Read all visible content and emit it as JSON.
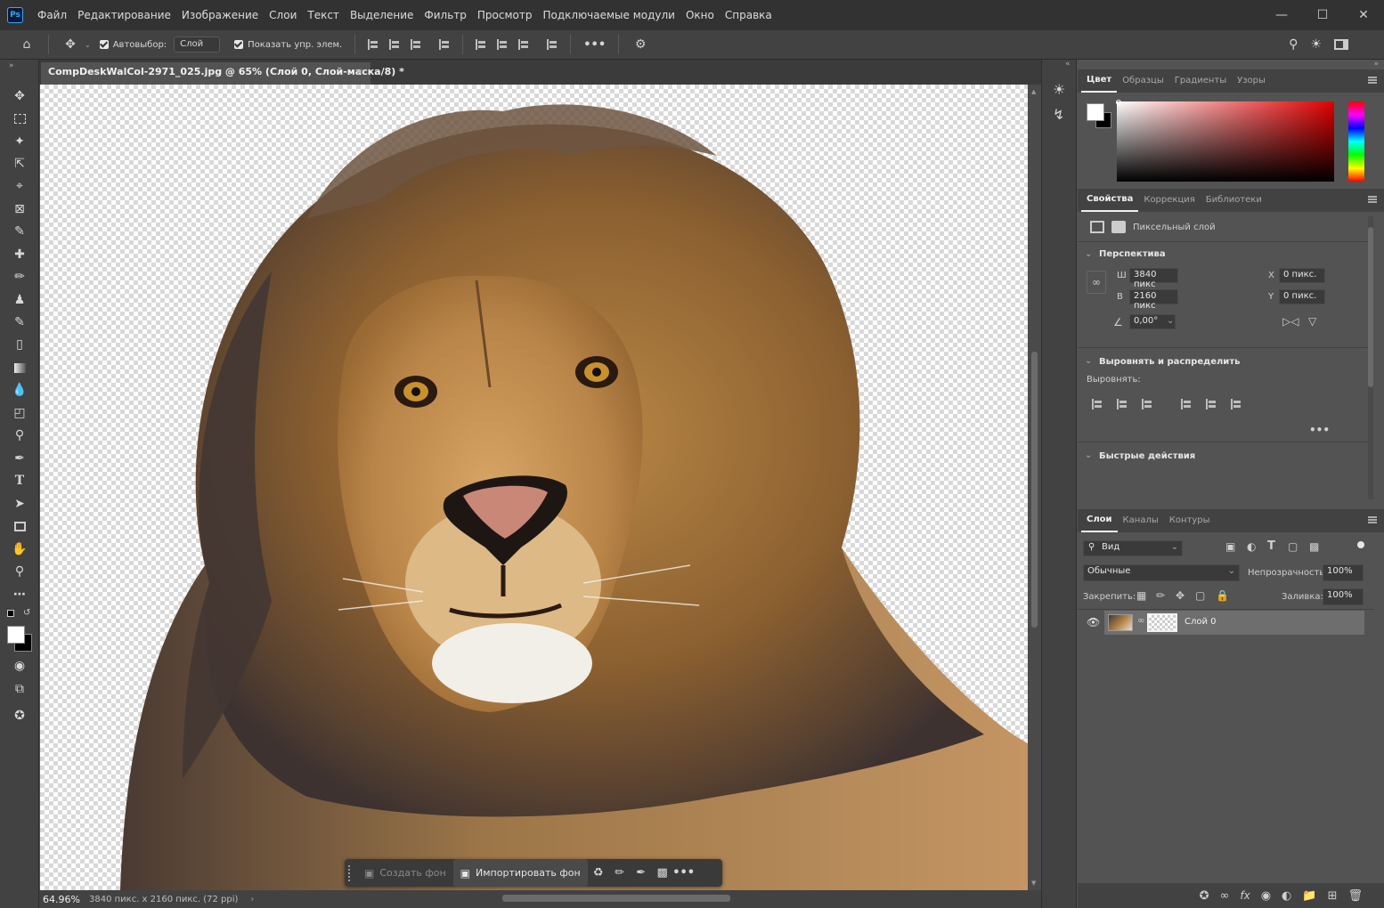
{
  "app": {
    "logo": "Ps",
    "menus": [
      "Файл",
      "Редактирование",
      "Изображение",
      "Слои",
      "Текст",
      "Выделение",
      "Фильтр",
      "Просмотр",
      "Подключаемые модули",
      "Окно",
      "Справка"
    ]
  },
  "options": {
    "autoselect_label": "Автовыбор:",
    "autoselect_value": "Слой",
    "show_controls_label": "Показать упр. элем.",
    "more": "•••"
  },
  "document": {
    "tab_title": "CompDeskWalCol-2971_025.jpg @ 65% (Слой 0, Слой-маска/8) *",
    "zoom": "64.96%",
    "dims": "3840 пикс. x 2160 пикс. (72 ppi)"
  },
  "context_bar": {
    "create_bg": "Создать фон",
    "import_bg": "Импортировать фон",
    "more": "•••"
  },
  "color_panel": {
    "tabs": [
      "Цвет",
      "Образцы",
      "Градиенты",
      "Узоры"
    ],
    "hue": "#ff0000"
  },
  "properties": {
    "tabs": [
      "Свойства",
      "Коррекция",
      "Библиотеки"
    ],
    "layer_type": "Пиксельный слой",
    "transform_section": "Перспектива",
    "w_label": "Ш",
    "w_value": "3840 пикс",
    "h_label": "В",
    "h_value": "2160 пикс",
    "x_label": "X",
    "x_value": "0 пикс.",
    "y_label": "Y",
    "y_value": "0 пикс.",
    "angle_value": "0,00°",
    "align_section": "Выровнять и распределить",
    "align_label": "Выровнять:",
    "more": "•••",
    "quick_section": "Быстрые действия"
  },
  "layers": {
    "tabs": [
      "Слои",
      "Каналы",
      "Контуры"
    ],
    "filter_value": "Вид",
    "blend_mode": "Обычные",
    "opacity_label": "Непрозрачность:",
    "opacity_value": "100%",
    "lock_label": "Закрепить:",
    "fill_label": "Заливка:",
    "fill_value": "100%",
    "items": [
      {
        "name": "Слой 0"
      }
    ]
  }
}
